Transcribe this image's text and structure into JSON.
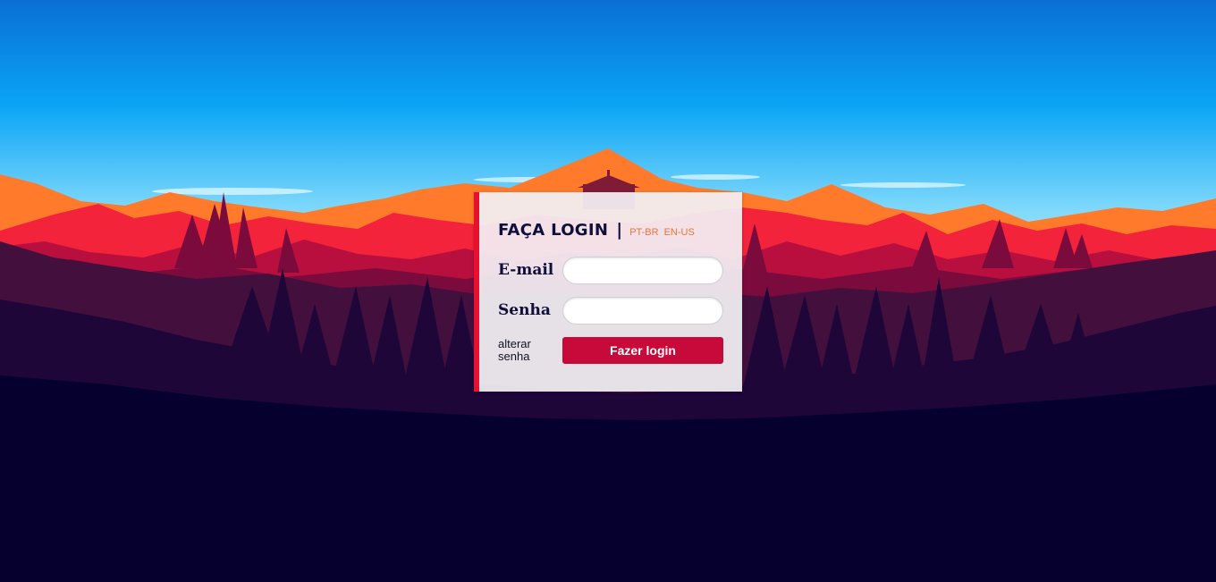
{
  "login": {
    "title": "FAÇA LOGIN",
    "separator": "|",
    "languages": [
      "PT-BR",
      "EN-US"
    ],
    "email_label": "E-mail",
    "email_value": "",
    "password_label": "Senha",
    "password_value": "",
    "change_password_line1": "alterar",
    "change_password_line2": "senha",
    "submit_label": "Fazer login"
  },
  "colors": {
    "accent": "#e8102e",
    "button": "#c70a3a",
    "title_text": "#0f0f3a",
    "language_link": "#e8743b",
    "sky_top": "#0a6fd6",
    "sky_horizon": "#bfeeff",
    "ground": "#06002e"
  }
}
